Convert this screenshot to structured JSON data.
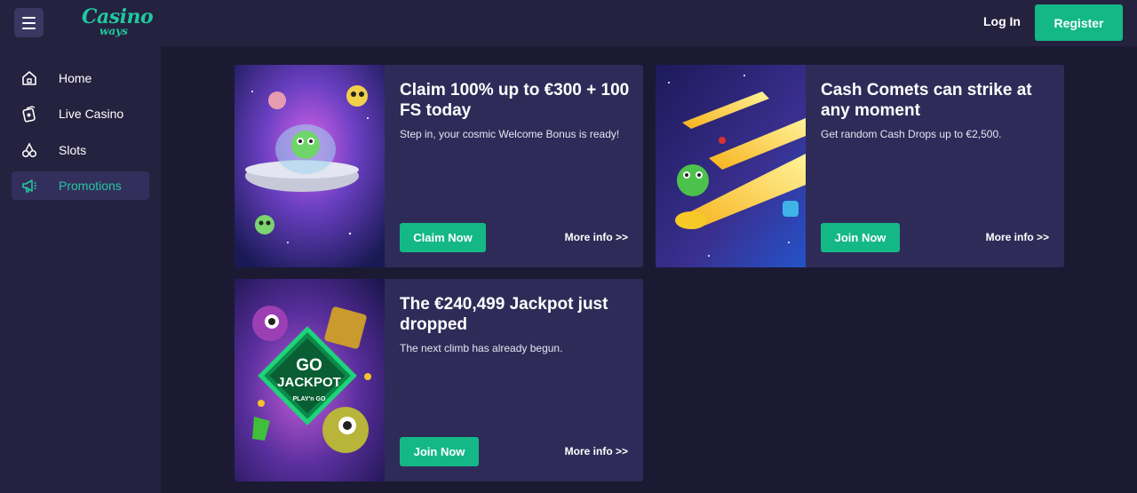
{
  "header": {
    "logo_line1": "Casino",
    "logo_line2": "ways",
    "login_label": "Log In",
    "register_label": "Register"
  },
  "sidebar": {
    "items": [
      {
        "label": "Home",
        "icon": "home-icon",
        "active": false
      },
      {
        "label": "Live Casino",
        "icon": "live-casino-icon",
        "active": false
      },
      {
        "label": "Slots",
        "icon": "cherries-icon",
        "active": false
      },
      {
        "label": "Promotions",
        "icon": "megaphone-icon",
        "active": true
      }
    ]
  },
  "promotions": [
    {
      "title": "Claim 100% up to €300 + 100 FS today",
      "description": "Step in, your cosmic Welcome Bonus is ready!",
      "cta_label": "Claim Now",
      "more_label": "More info >>",
      "art": "alien-ufo-illustration"
    },
    {
      "title": "Cash Comets can strike at any moment",
      "description": "Get random Cash Drops up to €2,500.",
      "cta_label": "Join Now",
      "more_label": "More info >>",
      "art": "comets-monster-illustration"
    },
    {
      "title": "The €240,499 Jackpot just dropped",
      "description": "The next climb has already begun.",
      "cta_label": "Join Now",
      "more_label": "More info >>",
      "art": "go-jackpot-illustration",
      "art_badge_line1": "GO",
      "art_badge_line2": "JACKPOT",
      "art_badge_brand": "PLAY'n GO"
    }
  ],
  "colors": {
    "accent": "#14b886",
    "active_text": "#27c69c",
    "card_bg": "#2f2b58",
    "page_bg": "#1c1a33",
    "header_bg": "#25223f"
  }
}
